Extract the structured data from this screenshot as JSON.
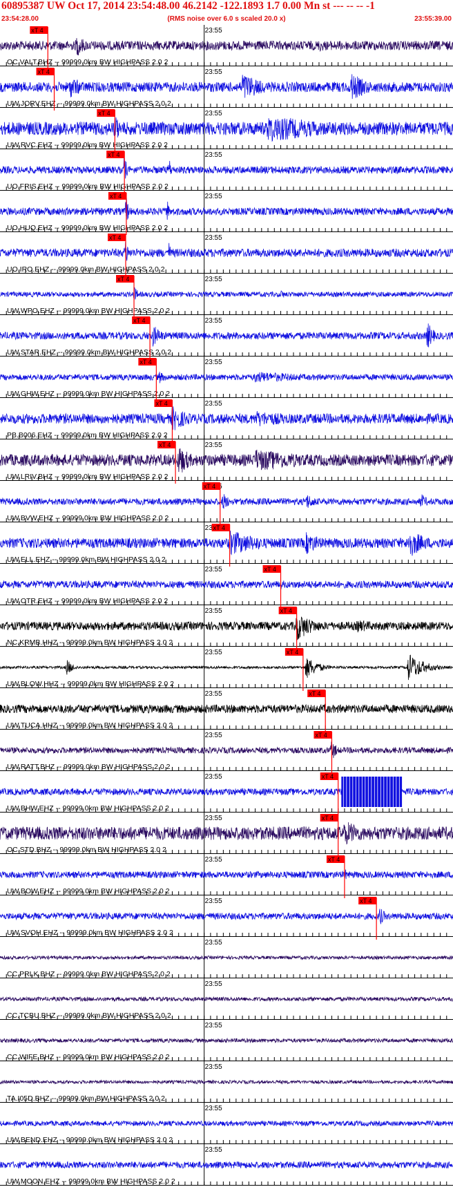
{
  "header": {
    "title": "60895387 UW Oct 17, 2014 23:54:48.00   46.2142 -122.1893  1.7 0.00 Mn st --- -- --  -1",
    "subtitle": "(RMS noise over 6.0 s scaled 20.0 x)",
    "start_time": "23:54:28.00",
    "end_time": "23:55:39.00"
  },
  "chart_data": {
    "type": "line",
    "title": "60895387 UW Oct 17, 2014 23:54:48.00   46.2142 -122.1893  1.7 0.00 Mn st --- -- --  -1",
    "x_range_seconds": [
      0,
      71
    ],
    "x_tick_interval_seconds": 1,
    "minute_marker": {
      "label": "23:55",
      "t": 32
    },
    "pick_label": "xT 4",
    "colors": {
      "blue": "#1010e0",
      "purple": "#2a0a60",
      "black": "#000000",
      "pick": "#ff0000"
    },
    "series": [
      {
        "label": "OC.VALT.BHZ -- 99999.0km BW  HIGHPASS  2.0  2",
        "color": "purple",
        "pick_t": 7.5,
        "amp": 0.28,
        "bursts": [
          [
            12,
            1.8,
            0.7
          ],
          [
            50,
            2.5,
            0.4
          ]
        ]
      },
      {
        "label": "UW.JORV.EHZ -- 99999.0km BW  HIGHPASS  2.0  2",
        "color": "blue",
        "pick_t": 8.5,
        "amp": 0.3,
        "bursts": [
          [
            11,
            2.5,
            0.7
          ],
          [
            38,
            3.5,
            0.9
          ],
          [
            55,
            3,
            0.9
          ]
        ]
      },
      {
        "label": "UW.RVC.EHZ -- 99999.0km BW  HIGHPASS  2.0  2",
        "color": "blue",
        "pick_t": 18,
        "amp": 0.4,
        "bursts": [
          [
            18,
            1,
            0.9
          ],
          [
            42,
            12,
            0.85
          ]
        ]
      },
      {
        "label": "UO.FRIS.EHZ -- 99999.0km BW  HIGHPASS  2.0  2",
        "color": "blue",
        "pick_t": 19.5,
        "amp": 0.22,
        "bursts": [
          [
            19.5,
            0.4,
            1.0
          ],
          [
            26.5,
            0.3,
            0.9
          ]
        ]
      },
      {
        "label": "UO.HUQ.EHZ -- 99999.0km BW  HIGHPASS  2.0  2",
        "color": "blue",
        "pick_t": 19.8,
        "amp": 0.22,
        "bursts": [
          [
            19.8,
            0.4,
            1.0
          ],
          [
            26.2,
            0.3,
            0.85
          ]
        ]
      },
      {
        "label": "UO.IRO.EHZ -- 99999.0km BW  HIGHPASS  2.0  2",
        "color": "blue",
        "pick_t": 19.7,
        "amp": 0.25,
        "bursts": [
          [
            19.7,
            0.4,
            1.0
          ],
          [
            26.5,
            0.3,
            0.7
          ]
        ]
      },
      {
        "label": "UW.WPO.EHZ -- 99999.0km BW  HIGHPASS  2.0  2",
        "color": "blue",
        "pick_t": 21,
        "amp": 0.15,
        "bursts": [
          [
            21,
            0.8,
            0.5
          ],
          [
            44,
            1,
            0.3
          ]
        ]
      },
      {
        "label": "UW.STAR.EHZ -- 99999.0km BW  HIGHPASS  2.0  2",
        "color": "blue",
        "pick_t": 23.5,
        "amp": 0.22,
        "bursts": [
          [
            24,
            1.5,
            0.7
          ],
          [
            67,
            1,
            0.9
          ]
        ]
      },
      {
        "label": "UW.GHW.EHZ -- 99999.0km BW  HIGHPASS  2.0  2",
        "color": "blue",
        "pick_t": 24.5,
        "amp": 0.18,
        "bursts": [
          [
            25,
            1,
            0.4
          ],
          [
            40,
            12,
            0.35
          ]
        ]
      },
      {
        "label": "PB.B006.EHZ -- 99999.0km BW  HIGHPASS  2.0  2",
        "color": "blue",
        "pick_t": 27,
        "amp": 0.3,
        "bursts": [
          [
            27,
            3,
            0.8
          ],
          [
            40,
            10,
            0.5
          ]
        ]
      },
      {
        "label": "UW.LRIV.BHZ -- 99999.0km BW  HIGHPASS  2.0  2",
        "color": "purple",
        "pick_t": 27.5,
        "amp": 0.35,
        "bursts": [
          [
            28,
            2,
            1.0
          ],
          [
            40,
            12,
            0.7
          ]
        ]
      },
      {
        "label": "UW.BVW.EHZ -- 99999.0km BW  HIGHPASS  2.0  2",
        "color": "blue",
        "pick_t": 34.5,
        "amp": 0.2,
        "bursts": [
          [
            35,
            1,
            0.6
          ],
          [
            48,
            2,
            0.5
          ],
          [
            66,
            1.2,
            0.5
          ]
        ]
      },
      {
        "label": "UW.ELL.EHZ -- 99999.0km BW  HIGHPASS  2.0  2",
        "color": "blue",
        "pick_t": 36,
        "amp": 0.3,
        "bursts": [
          [
            36,
            6,
            0.8
          ],
          [
            48,
            3,
            0.7
          ],
          [
            64,
            3,
            0.95
          ]
        ]
      },
      {
        "label": "UW.OTR.EHZ -- 99999.0km BW  HIGHPASS  2.0  2",
        "color": "blue",
        "pick_t": 44,
        "amp": 0.22,
        "bursts": [
          [
            44,
            2,
            0.3
          ]
        ]
      },
      {
        "label": "NC.KRMB.HHZ -- 99999.0km BW  HIGHPASS  2.0  2",
        "color": "black",
        "pick_t": 46.5,
        "amp": 0.25,
        "bursts": [
          [
            46.5,
            3,
            0.9
          ],
          [
            56,
            5,
            0.4
          ]
        ]
      },
      {
        "label": "UW.BLOW.HHZ -- 99999.0km BW  HIGHPASS  2.0  2",
        "color": "black",
        "pick_t": 47.5,
        "amp": 0.08,
        "bursts": [
          [
            10.5,
            1,
            0.5
          ],
          [
            48,
            2,
            0.7
          ],
          [
            64,
            2.5,
            0.9
          ]
        ]
      },
      {
        "label": "UW.TUCA.HHZ -- 99999.0km BW  HIGHPASS  2.0  2",
        "color": "black",
        "pick_t": 51,
        "amp": 0.25,
        "bursts": [
          [
            51,
            1,
            0.4
          ]
        ]
      },
      {
        "label": "UW.RATT.BHZ -- 99999.0km BW  HIGHPASS  2.0  2",
        "color": "purple",
        "pick_t": 52,
        "amp": 0.18,
        "bursts": [
          [
            52,
            0.8,
            0.7
          ]
        ]
      },
      {
        "label": "UW.BHW.EHZ -- 99999.0km BW  HIGHPASS  2.0  2",
        "color": "blue",
        "pick_t": 53,
        "amp": 0.2,
        "bursts": [],
        "clipped": [
          53.5,
          63
        ]
      },
      {
        "label": "OC.STD.BHZ -- 99999.0km BW  HIGHPASS  2.0  2",
        "color": "purple",
        "pick_t": 53,
        "amp": 0.4,
        "bursts": [
          [
            54,
            4,
            0.8
          ]
        ]
      },
      {
        "label": "UW.BOW.EHZ -- 99999.0km BW  HIGHPASS  2.0  2",
        "color": "blue",
        "pick_t": 54,
        "amp": 0.2,
        "bursts": [
          [
            54,
            0.8,
            0.4
          ]
        ]
      },
      {
        "label": "UW.SVOH.EHZ -- 99999.0km BW  HIGHPASS  2.0  2",
        "color": "blue",
        "pick_t": 59,
        "amp": 0.2,
        "bursts": [
          [
            59.5,
            1,
            0.6
          ]
        ]
      },
      {
        "label": "CC.PRLK.BHZ -- 99999.0km BW  HIGHPASS  2.0  2",
        "color": "purple",
        "pick_t": null,
        "amp": 0.1,
        "bursts": []
      },
      {
        "label": "CC.TCBU.BHZ -- 99999.0km BW  HIGHPASS  2.0  2",
        "color": "purple",
        "pick_t": null,
        "amp": 0.12,
        "bursts": []
      },
      {
        "label": "CC.WIFE.BHZ -- 99999.0km BW  HIGHPASS  2.0  2",
        "color": "purple",
        "pick_t": null,
        "amp": 0.12,
        "bursts": []
      },
      {
        "label": "TA.I05D.BHZ -- 99999.0km BW  HIGHPASS  2.0  2",
        "color": "purple",
        "pick_t": null,
        "amp": 0.1,
        "bursts": []
      },
      {
        "label": "UW.BEND.EHZ -- 99999.0km BW  HIGHPASS  2.0  2",
        "color": "blue",
        "pick_t": null,
        "amp": 0.15,
        "bursts": []
      },
      {
        "label": "UW.MOON.EHZ -- 99999.0km BW  HIGHPASS  2.0  2",
        "color": "blue",
        "pick_t": null,
        "amp": 0.2,
        "bursts": []
      }
    ]
  }
}
